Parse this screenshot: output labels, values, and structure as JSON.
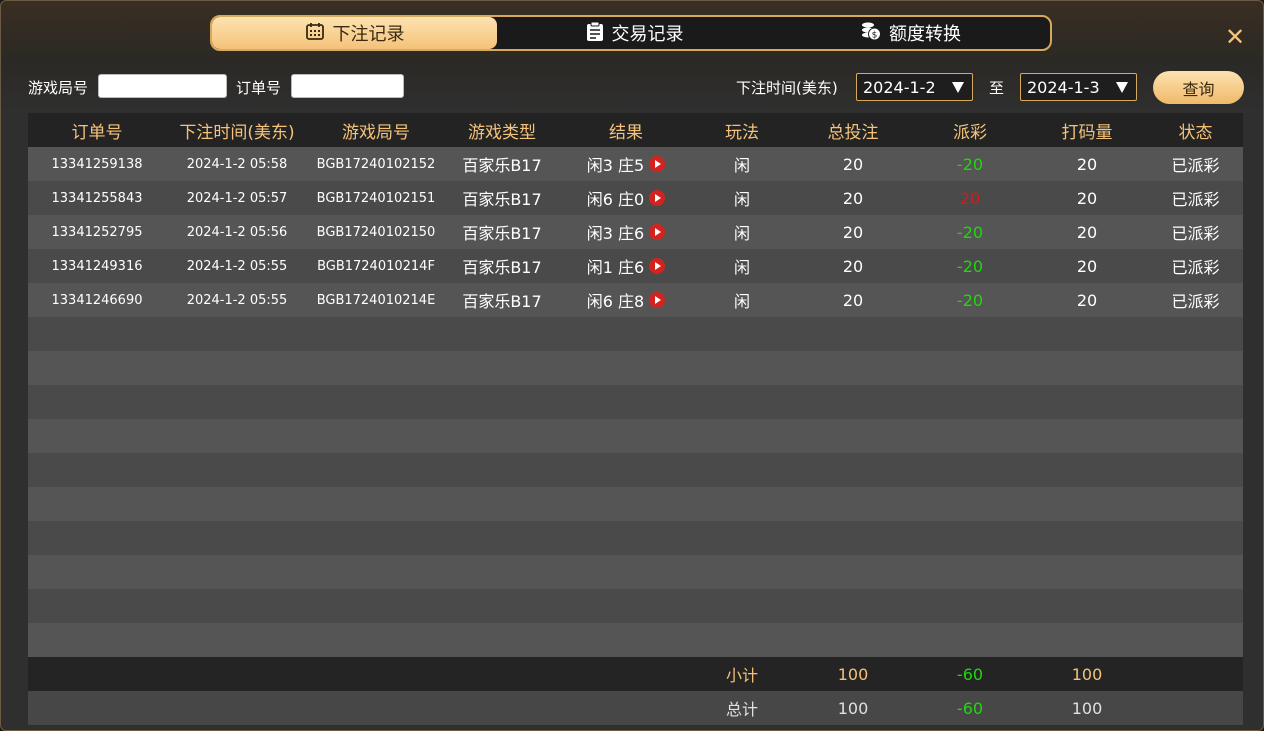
{
  "tabs": [
    {
      "label": "下注记录",
      "icon": "calendar-icon",
      "active": true
    },
    {
      "label": "交易记录",
      "icon": "clipboard-icon",
      "active": false
    },
    {
      "label": "额度转换",
      "icon": "coins-icon",
      "active": false
    }
  ],
  "close_label": "✕",
  "filters": {
    "game_round_label": "游戏局号",
    "game_round_value": "",
    "order_label": "订单号",
    "order_value": "",
    "time_label": "下注时间(美东)",
    "date_from": "2024-1-2",
    "to_label": "至",
    "date_to": "2024-1-3",
    "query_label": "查询"
  },
  "columns": [
    "订单号",
    "下注时间(美东)",
    "游戏局号",
    "游戏类型",
    "结果",
    "玩法",
    "总投注",
    "派彩",
    "打码量",
    "状态"
  ],
  "rows": [
    {
      "order": "13341259138",
      "time": "2024-1-2 05:58",
      "round": "BGB17240102152",
      "game": "百家乐B17",
      "result": "闲3 庄5",
      "play": "闲",
      "bet": "20",
      "payout": "-20",
      "payout_color": "#22d60f",
      "turnover": "20",
      "status": "已派彩"
    },
    {
      "order": "13341255843",
      "time": "2024-1-2 05:57",
      "round": "BGB17240102151",
      "game": "百家乐B17",
      "result": "闲6 庄0",
      "play": "闲",
      "bet": "20",
      "payout": "20",
      "payout_color": "#d81818",
      "turnover": "20",
      "status": "已派彩"
    },
    {
      "order": "13341252795",
      "time": "2024-1-2 05:56",
      "round": "BGB17240102150",
      "game": "百家乐B17",
      "result": "闲3 庄6",
      "play": "闲",
      "bet": "20",
      "payout": "-20",
      "payout_color": "#22d60f",
      "turnover": "20",
      "status": "已派彩"
    },
    {
      "order": "13341249316",
      "time": "2024-1-2 05:55",
      "round": "BGB1724010214F",
      "game": "百家乐B17",
      "result": "闲1 庄6",
      "play": "闲",
      "bet": "20",
      "payout": "-20",
      "payout_color": "#22d60f",
      "turnover": "20",
      "status": "已派彩"
    },
    {
      "order": "13341246690",
      "time": "2024-1-2 05:55",
      "round": "BGB1724010214E",
      "game": "百家乐B17",
      "result": "闲6 庄8",
      "play": "闲",
      "bet": "20",
      "payout": "-20",
      "payout_color": "#22d60f",
      "turnover": "20",
      "status": "已派彩"
    }
  ],
  "empty_rows": 10,
  "subtotal": {
    "label": "小计",
    "bet": "100",
    "payout": "-60",
    "turnover": "100"
  },
  "total": {
    "label": "总计",
    "bet": "100",
    "payout": "-60",
    "turnover": "100"
  },
  "colors": {
    "accent": "#f4c27a",
    "loss_green": "#22d60f",
    "win_red": "#d81818"
  }
}
